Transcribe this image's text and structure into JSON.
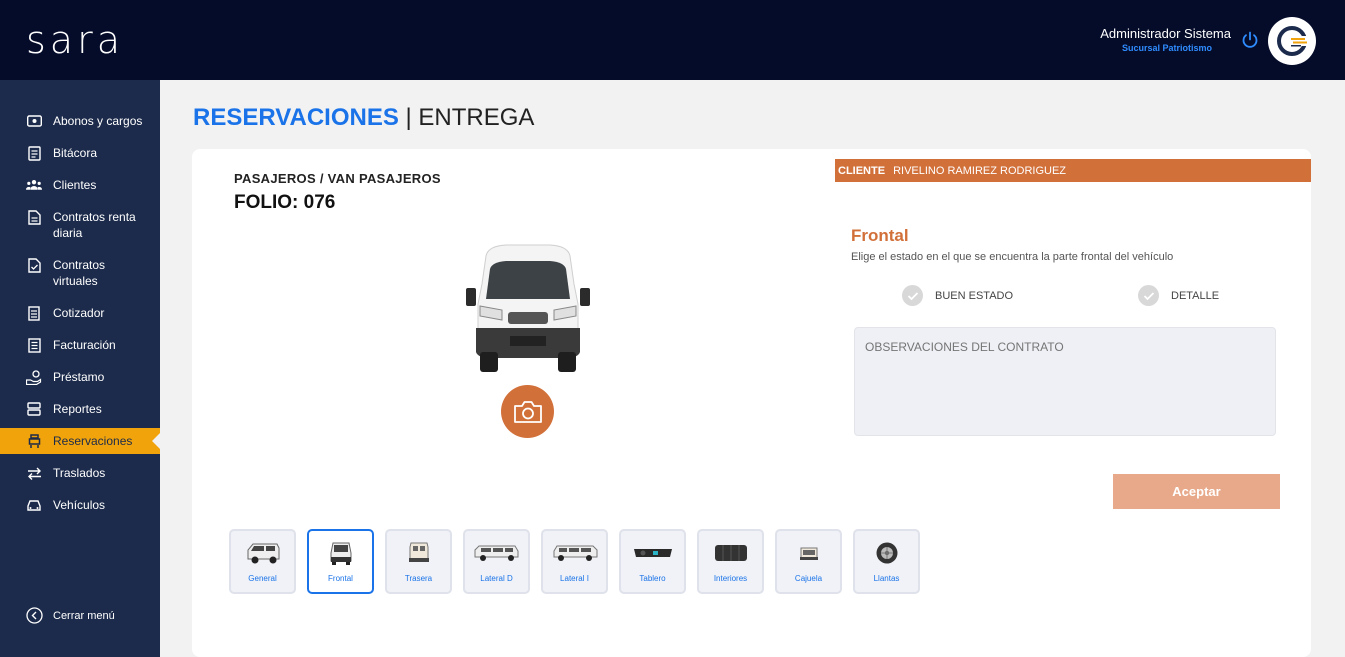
{
  "header": {
    "logo": "sara",
    "user_name": "Administrador Sistema",
    "branch": "Sucursal Patriotismo"
  },
  "sidebar": {
    "items": [
      {
        "label": "Abonos y cargos",
        "icon": "money-icon"
      },
      {
        "label": "Bitácora",
        "icon": "logbook-icon"
      },
      {
        "label": "Clientes",
        "icon": "users-icon"
      },
      {
        "label": "Contratos renta diaria",
        "icon": "contract-icon"
      },
      {
        "label": "Contratos virtuales",
        "icon": "virtual-contract-icon"
      },
      {
        "label": "Cotizador",
        "icon": "quote-icon"
      },
      {
        "label": "Facturación",
        "icon": "invoice-icon"
      },
      {
        "label": "Préstamo",
        "icon": "loan-icon"
      },
      {
        "label": "Reportes",
        "icon": "reports-icon"
      },
      {
        "label": "Reservaciones",
        "icon": "reservations-icon",
        "active": true
      },
      {
        "label": "Traslados",
        "icon": "transfer-icon"
      },
      {
        "label": "Vehículos",
        "icon": "car-icon"
      }
    ],
    "close_menu": "Cerrar menú"
  },
  "page": {
    "title_main": "RESERVACIONES",
    "title_sep": "|",
    "title_sub": "ENTREGA"
  },
  "vehicle": {
    "category": "PASAJEROS / VAN PASAJEROS",
    "folio": "FOLIO: 076"
  },
  "client": {
    "label": "CLIENTE",
    "name": "RIVELINO RAMIREZ RODRIGUEZ"
  },
  "inspection": {
    "section_title": "Frontal",
    "description": "Elige el estado en el que se encuentra la parte frontal del vehículo",
    "options": [
      "BUEN ESTADO",
      "DETALLE"
    ],
    "observations_placeholder": "OBSERVACIONES DEL CONTRATO",
    "accept_label": "Aceptar"
  },
  "thumbnails": [
    {
      "label": "General",
      "icon": "van-side-icon"
    },
    {
      "label": "Frontal",
      "icon": "van-front-icon",
      "selected": true
    },
    {
      "label": "Trasera",
      "icon": "van-rear-icon"
    },
    {
      "label": "Lateral D",
      "icon": "van-right-icon"
    },
    {
      "label": "Lateral I",
      "icon": "van-left-icon"
    },
    {
      "label": "Tablero",
      "icon": "dashboard-icon"
    },
    {
      "label": "Interiores",
      "icon": "seats-icon"
    },
    {
      "label": "Cajuela",
      "icon": "trunk-icon"
    },
    {
      "label": "Llantas",
      "icon": "tire-icon"
    }
  ],
  "colors": {
    "topbar": "#050c2a",
    "sidebar": "#1c2b4b",
    "active_nav": "#f0a30a",
    "accent_orange": "#d2703a",
    "accent_blue": "#1a73e8"
  }
}
